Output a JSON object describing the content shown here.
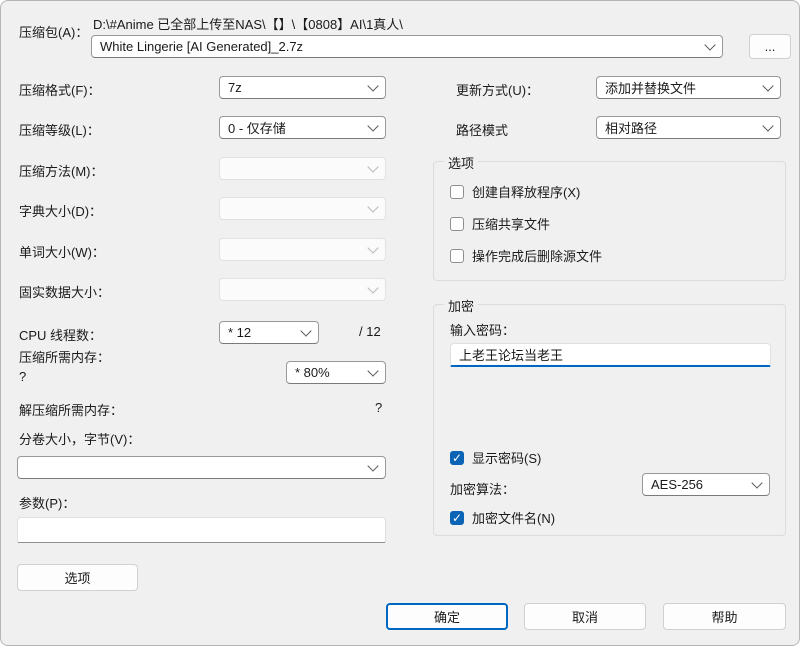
{
  "archive": {
    "label": "压缩包(A)：",
    "path": "D:\\#Anime 已全部上传至NAS\\【】\\【0808】AI\\1真人\\",
    "name": "White Lingerie [AI Generated]_2.7z",
    "browse_label": "..."
  },
  "left_fields": {
    "format": {
      "label": "压缩格式(F)：",
      "value": "7z"
    },
    "level": {
      "label": "压缩等级(L)：",
      "value": "0 - 仅存储"
    },
    "method": {
      "label": "压缩方法(M)：",
      "value": ""
    },
    "dict": {
      "label": "字典大小(D)：",
      "value": ""
    },
    "word": {
      "label": "单词大小(W)：",
      "value": ""
    },
    "solid": {
      "label": "固实数据大小：",
      "value": ""
    },
    "threads": {
      "label": "CPU 线程数：",
      "value": "* 12",
      "suffix": "/ 12"
    },
    "mem_compress": {
      "label": "压缩所需内存：",
      "hint": "?",
      "value": "* 80%"
    },
    "mem_decompress": {
      "label": "解压缩所需内存：",
      "value": "?"
    },
    "volume": {
      "label": "分卷大小，字节(V)：",
      "value": ""
    },
    "params": {
      "label": "参数(P)：",
      "value": ""
    }
  },
  "right_fields": {
    "update_mode": {
      "label": "更新方式(U)：",
      "value": "添加并替换文件"
    },
    "path_mode": {
      "label": "路径模式",
      "value": "相对路径"
    }
  },
  "options_group": {
    "title": "选项",
    "checkboxes": [
      {
        "label": "创建自释放程序(X)",
        "checked": false
      },
      {
        "label": "压缩共享文件",
        "checked": false
      },
      {
        "label": "操作完成后删除源文件",
        "checked": false
      }
    ]
  },
  "encryption_group": {
    "title": "加密",
    "password_label": "输入密码：",
    "password_value": "上老王论坛当老王",
    "show_password": {
      "label": "显示密码(S)",
      "checked": true
    },
    "method_label": "加密算法：",
    "method_value": "AES-256",
    "encrypt_names": {
      "label": "加密文件名(N)",
      "checked": true
    }
  },
  "buttons": {
    "options": "选项",
    "ok": "确定",
    "cancel": "取消",
    "help": "帮助"
  },
  "colors": {
    "accent": "#0067c0",
    "dialog_bg": "#f0f0f0"
  }
}
